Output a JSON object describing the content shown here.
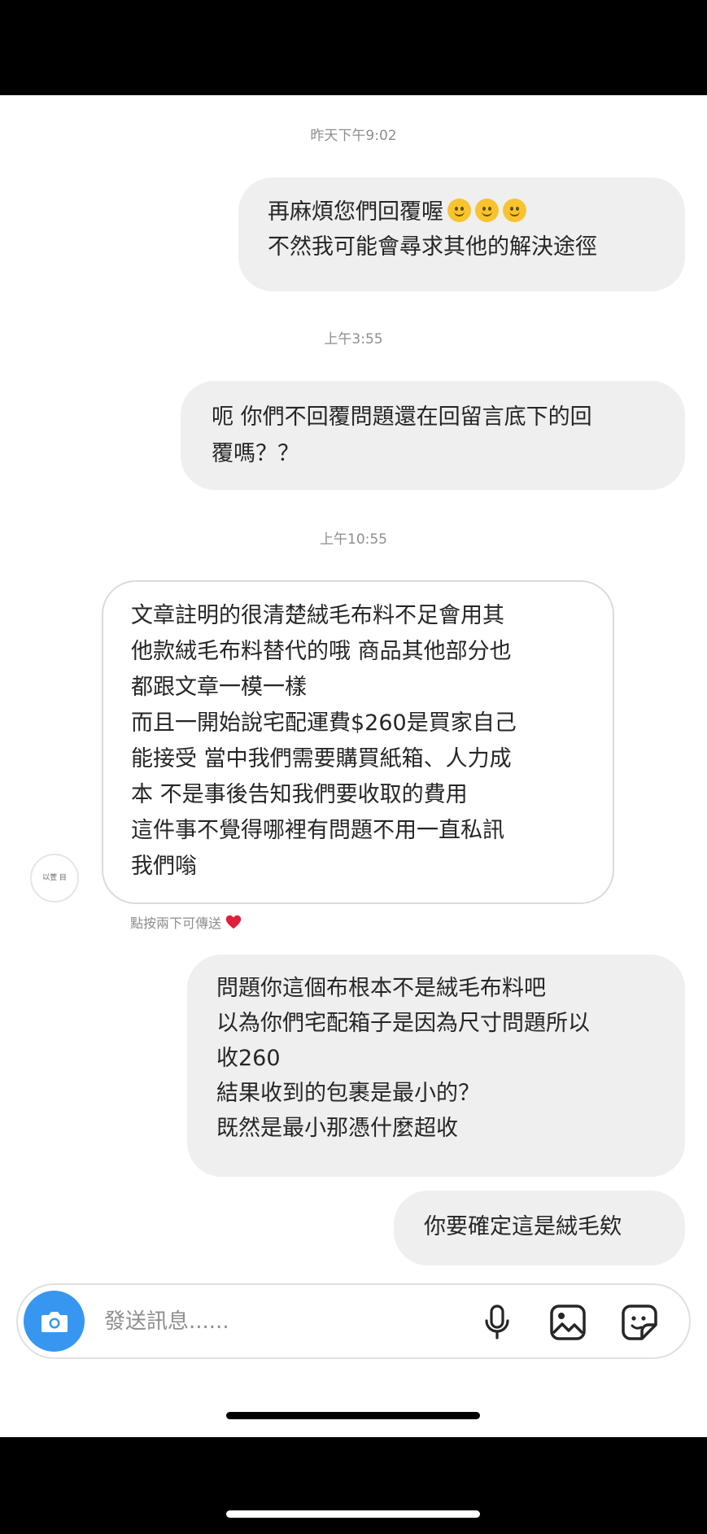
{
  "timestamps": [
    "昨天下午9:02",
    "上午3:55",
    "上午10:55"
  ],
  "messages": [
    {
      "from": "me",
      "lines": [
        "再麻煩您們回覆喔",
        "不然我可能會尋求其他的解決途徑"
      ]
    },
    {
      "from": "me",
      "lines": [
        "呃 你們不回覆問題還在回留言底下的回",
        "覆嗎？？"
      ]
    },
    {
      "from": "them",
      "lines": [
        "文章註明的很清楚絨毛布料不足會用其",
        "他款絨毛布料替代的哦 商品其他部分也",
        "都跟文章一模一樣",
        "而且一開始說宅配運費$260是買家自己",
        "能接受 當中我們需要購買紙箱、人力成",
        "本 不是事後告知我們要收取的費用",
        "這件事不覺得哪裡有問題不用一直私訊",
        "我們嗡"
      ]
    },
    {
      "from": "me",
      "lines": [
        "問題你這個布根本不是絨毛布料吧",
        "以為你們宅配箱子是因為尺寸問題所以",
        "收260",
        "結果收到的包裹是最小的？",
        "既然是最小那憑什麼超收"
      ]
    },
    {
      "from": "me",
      "lines": [
        "你要確定這是絨毛欸"
      ]
    }
  ],
  "emoji": {
    "name": "slightly-smiling-face",
    "count": 3
  },
  "avatar_label": "以萱 目",
  "reaction_hint": "點按兩下可傳送",
  "composer": {
    "placeholder": "發送訊息......",
    "accent_color": "#3797f0"
  },
  "icons": [
    "camera-icon",
    "microphone-icon",
    "image-icon",
    "sticker-icon",
    "heart-icon",
    "smile-emoji"
  ]
}
